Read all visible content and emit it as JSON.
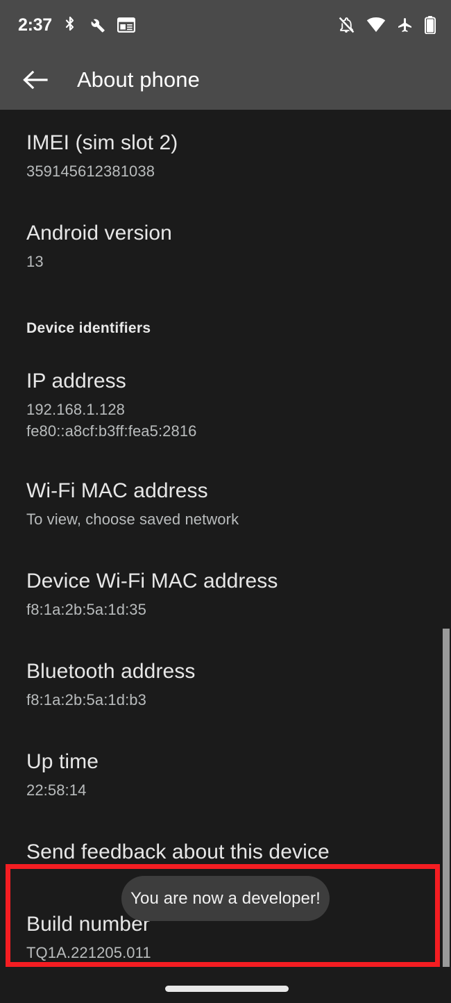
{
  "status_bar": {
    "clock": "2:37",
    "left_icons": [
      {
        "name": "bluetooth-icon"
      },
      {
        "name": "wrench-icon"
      },
      {
        "name": "notes-window-icon"
      }
    ],
    "right_icons": [
      {
        "name": "notifications-off-icon"
      },
      {
        "name": "wifi-icon"
      },
      {
        "name": "airplane-mode-icon"
      },
      {
        "name": "battery-icon"
      }
    ],
    "background": "#4a4a4a"
  },
  "app_bar": {
    "back_label": "Back",
    "title": "About phone",
    "background": "#4a4a4a"
  },
  "content": {
    "rows": [
      {
        "key": "imei-sim-slot-2",
        "title": "IMEI (sim slot 2)",
        "value": "359145612381038"
      },
      {
        "key": "android-version",
        "title": "Android version",
        "value": "13"
      },
      {
        "key": "ip-address",
        "title": "IP address",
        "value": "192.168.1.128",
        "value2": "fe80::a8cf:b3ff:fea5:2816"
      },
      {
        "key": "wifi-mac-address",
        "title": "Wi-Fi MAC address",
        "value": "To view, choose saved network"
      },
      {
        "key": "device-wifi-mac-address",
        "title": "Device Wi-Fi MAC address",
        "value": "f8:1a:2b:5a:1d:35"
      },
      {
        "key": "bluetooth-address",
        "title": "Bluetooth address",
        "value": "f8:1a:2b:5a:1d:b3"
      },
      {
        "key": "up-time",
        "title": "Up time",
        "value": "22:58:14"
      },
      {
        "key": "send-feedback",
        "title": "Send feedback about this device",
        "value": ""
      },
      {
        "key": "build-number",
        "title": "Build number",
        "value": "TQ1A.221205.011"
      }
    ],
    "section_header": "Device identifiers",
    "background": "#1b1b1b"
  },
  "toast": {
    "message": "You are now a developer!",
    "background": "#3d3d3d"
  },
  "highlight": {
    "color": "#f41d22",
    "target": "build-number"
  },
  "scrollbar": {
    "color": "#9a9a9a"
  },
  "nav_bar": {
    "gesture_pill_label": "Home gesture handle"
  }
}
